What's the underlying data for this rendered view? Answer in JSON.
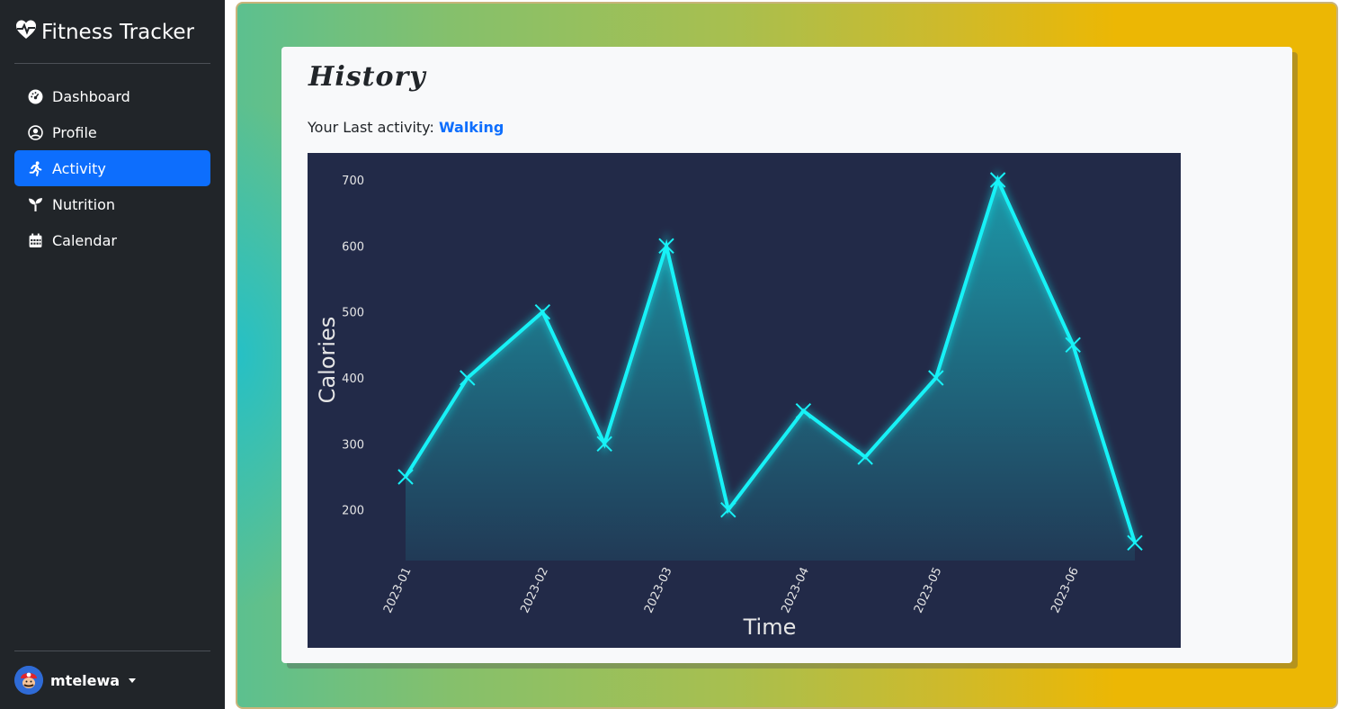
{
  "app": {
    "title": "Fitness Tracker"
  },
  "sidebar": {
    "items": [
      {
        "label": "Dashboard",
        "icon": "speedometer-icon"
      },
      {
        "label": "Profile",
        "icon": "person-circle-icon"
      },
      {
        "label": "Activity",
        "icon": "running-person-icon",
        "active": true
      },
      {
        "label": "Nutrition",
        "icon": "sprout-icon"
      },
      {
        "label": "Calendar",
        "icon": "calendar-icon"
      }
    ],
    "user": {
      "name": "mtelewa"
    }
  },
  "main": {
    "title": "History",
    "last_activity_prefix": "Your Last activity:",
    "last_activity": "Walking"
  },
  "colors": {
    "sidebar_bg": "#212529",
    "accent": "#0d6efd",
    "chart_bg": "#222a48",
    "line": "#17f2f7"
  },
  "chart_data": {
    "type": "area",
    "xlabel": "Time",
    "ylabel": "Calories",
    "x": [
      "2023-01-01",
      "2023-01-15",
      "2023-02-01",
      "2023-02-15",
      "2023-03-01",
      "2023-03-15",
      "2023-04-01",
      "2023-04-15",
      "2023-05-01",
      "2023-05-15",
      "2023-06-01",
      "2023-06-15"
    ],
    "values": [
      250,
      400,
      500,
      300,
      600,
      200,
      350,
      280,
      400,
      700,
      450,
      150
    ],
    "x_ticks": [
      "2023-01",
      "2023-02",
      "2023-03",
      "2023-04",
      "2023-05",
      "2023-06"
    ],
    "y_ticks": [
      200,
      300,
      400,
      500,
      600,
      700
    ],
    "marker": "x",
    "grid": false
  }
}
